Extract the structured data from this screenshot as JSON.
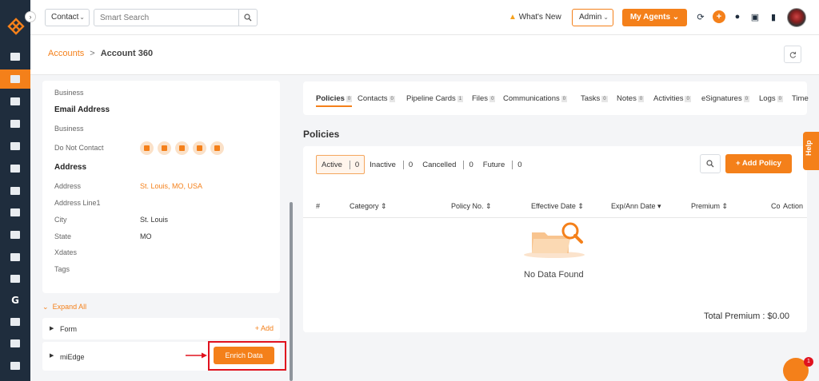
{
  "topbar": {
    "contact_select": "Contact",
    "search_placeholder": "Smart Search",
    "whats_new": "What's New",
    "admin_select": "Admin",
    "my_agents": "My Agents"
  },
  "breadcrumb": {
    "parent": "Accounts",
    "separator": ">",
    "current": "Account 360"
  },
  "details": {
    "business_1": "Business",
    "email_heading": "Email Address",
    "business_2": "Business",
    "do_not_contact_label": "Do Not Contact",
    "address_heading": "Address",
    "fields": [
      {
        "label": "Address",
        "value": "St. Louis, MO, USA"
      },
      {
        "label": "Address Line1",
        "value": ""
      },
      {
        "label": "City",
        "value": "St. Louis"
      },
      {
        "label": "State",
        "value": "MO"
      },
      {
        "label": "Xdates",
        "value": ""
      },
      {
        "label": "Tags",
        "value": ""
      }
    ]
  },
  "sections": {
    "expand_all": "Expand All",
    "form_label": "Form",
    "add_label": "+ Add",
    "miedge_label": "miEdge",
    "enrich_button": "Enrich Data"
  },
  "tabs": [
    {
      "label": "Policies",
      "count": "0"
    },
    {
      "label": "Contacts",
      "count": "0"
    },
    {
      "label": "Pipeline Cards",
      "count": "1"
    },
    {
      "label": "Files",
      "count": "0"
    },
    {
      "label": "Communications",
      "count": "0"
    },
    {
      "label": "Tasks",
      "count": "0"
    },
    {
      "label": "Notes",
      "count": "0"
    },
    {
      "label": "Activities",
      "count": "0"
    },
    {
      "label": "eSignatures",
      "count": "0"
    },
    {
      "label": "Logs",
      "count": "0"
    },
    {
      "label": "Time",
      "count": ""
    }
  ],
  "policies": {
    "title": "Policies",
    "filters": [
      {
        "label": "Active",
        "count": "0"
      },
      {
        "label": "Inactive",
        "count": "0"
      },
      {
        "label": "Cancelled",
        "count": "0"
      },
      {
        "label": "Future",
        "count": "0"
      }
    ],
    "add_policy": "+ Add Policy",
    "columns": [
      "#",
      "Category ⇕",
      "Policy No. ⇕",
      "Effective Date ⇕",
      "Exp/Ann Date ▾",
      "Premium ⇕",
      "Co",
      "Action"
    ],
    "empty_text": "No Data Found",
    "total": "Total Premium : $0.00"
  },
  "help_label": "Help",
  "chat_badge": "1",
  "colors": {
    "accent": "#f4801a",
    "sidebar": "#1f2d3d",
    "highlight": "#e0121e"
  }
}
